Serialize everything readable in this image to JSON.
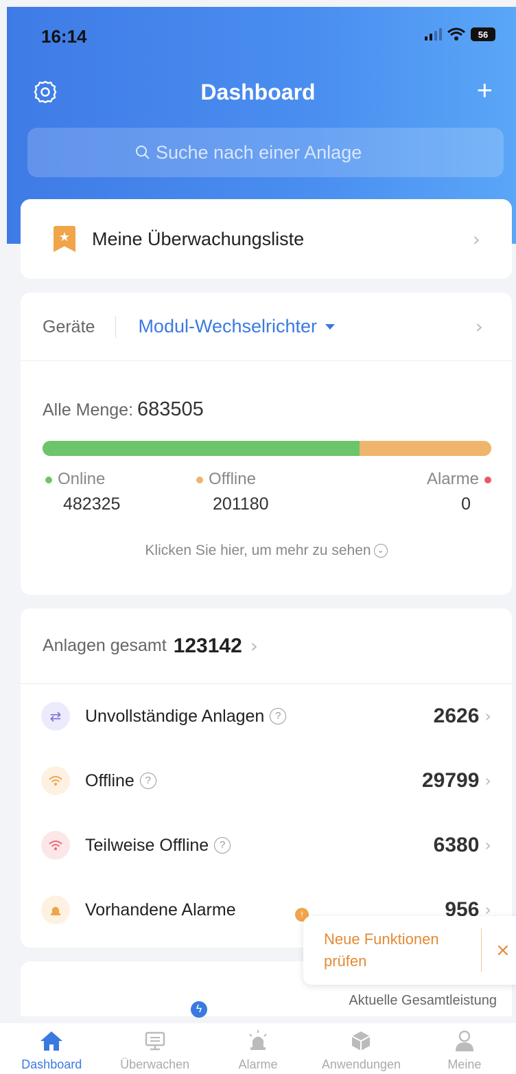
{
  "status_bar": {
    "time": "16:14",
    "battery": "56"
  },
  "header": {
    "title": "Dashboard",
    "search_placeholder": "Suche nach einer Anlage"
  },
  "watchlist": {
    "label": "Meine Überwachungsliste"
  },
  "devices": {
    "label": "Geräte",
    "selected_type": "Modul-Wechselrichter",
    "total_label": "Alle Menge:",
    "total_value": "683505",
    "online_label": "Online",
    "online_value": "482325",
    "offline_label": "Offline",
    "offline_value": "201180",
    "alarm_label": "Alarme",
    "alarm_value": "0",
    "online_fraction": 0.7057,
    "more_link": "Klicken Sie hier, um mehr zu sehen"
  },
  "plants": {
    "total_label": "Anlagen gesamt",
    "total_value": "123142",
    "rows": [
      {
        "label": "Unvollständige Anlagen",
        "value": "2626",
        "help": true,
        "icon": "link-icon",
        "color": "#7a6fe0"
      },
      {
        "label": "Offline",
        "value": "29799",
        "help": true,
        "icon": "wifi-icon",
        "color": "#f0a54a"
      },
      {
        "label": "Teilweise Offline",
        "value": "6380",
        "help": true,
        "icon": "wifi-icon",
        "color": "#ea6a73"
      },
      {
        "label": "Vorhandene Alarme",
        "value": "956",
        "help": false,
        "icon": "alarm-icon",
        "color": "#f0a54a"
      }
    ]
  },
  "power": {
    "label": "Aktuelle Gesamtleistung"
  },
  "toast": {
    "text": "Neue Funktionen prüfen"
  },
  "tabs": [
    {
      "label": "Dashboard",
      "icon": "home-icon",
      "active": true
    },
    {
      "label": "Überwachen",
      "icon": "monitor-icon",
      "active": false
    },
    {
      "label": "Alarme",
      "icon": "alarm-icon",
      "active": false
    },
    {
      "label": "Anwendungen",
      "icon": "cube-icon",
      "active": false
    },
    {
      "label": "Meine",
      "icon": "user-icon",
      "active": false
    }
  ],
  "colors": {
    "brand": "#3f7be6",
    "online": "#6cc56b",
    "offline": "#f0b56c",
    "alarm": "#ea5a63",
    "accent": "#3a7ae0"
  }
}
